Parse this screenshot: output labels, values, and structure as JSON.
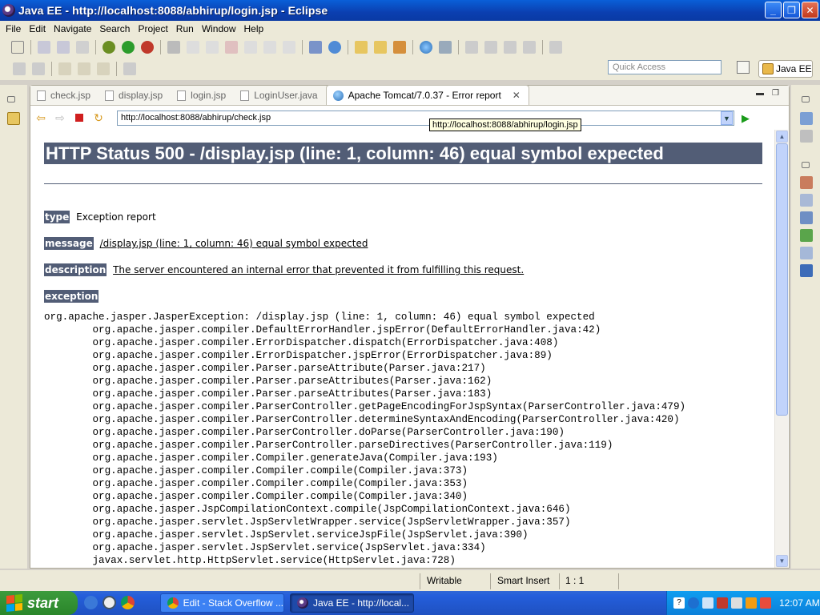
{
  "window": {
    "title": "Java EE - http://localhost:8088/abhirup/login.jsp - Eclipse"
  },
  "menu": [
    "File",
    "Edit",
    "Navigate",
    "Search",
    "Project",
    "Run",
    "Window",
    "Help"
  ],
  "toolbar": {
    "quick_access_placeholder": "Quick Access",
    "perspective_label": "Java EE"
  },
  "tabs": [
    {
      "label": "check.jsp"
    },
    {
      "label": "display.jsp"
    },
    {
      "label": "login.jsp"
    },
    {
      "label": "LoginUser.java"
    },
    {
      "label": "Apache Tomcat/7.0.37 - Error report"
    }
  ],
  "browser": {
    "url": "http://localhost:8088/abhirup/check.jsp",
    "tooltip": "http://localhost:8088/abhirup/login.jsp"
  },
  "page": {
    "heading": "HTTP Status 500 - /display.jsp (line: 1, column: 46) equal symbol expected",
    "type_label": "type",
    "type_value": "Exception report",
    "message_label": "message",
    "message_value": "/display.jsp (line: 1, column: 46) equal symbol expected",
    "description_label": "description",
    "description_value": "The server encountered an internal error that prevented it from fulfilling this request.",
    "exception_label": "exception",
    "stack_trace": "org.apache.jasper.JasperException: /display.jsp (line: 1, column: 46) equal symbol expected\n\torg.apache.jasper.compiler.DefaultErrorHandler.jspError(DefaultErrorHandler.java:42)\n\torg.apache.jasper.compiler.ErrorDispatcher.dispatch(ErrorDispatcher.java:408)\n\torg.apache.jasper.compiler.ErrorDispatcher.jspError(ErrorDispatcher.java:89)\n\torg.apache.jasper.compiler.Parser.parseAttribute(Parser.java:217)\n\torg.apache.jasper.compiler.Parser.parseAttributes(Parser.java:162)\n\torg.apache.jasper.compiler.Parser.parseAttributes(Parser.java:183)\n\torg.apache.jasper.compiler.ParserController.getPageEncodingForJspSyntax(ParserController.java:479)\n\torg.apache.jasper.compiler.ParserController.determineSyntaxAndEncoding(ParserController.java:420)\n\torg.apache.jasper.compiler.ParserController.doParse(ParserController.java:190)\n\torg.apache.jasper.compiler.ParserController.parseDirectives(ParserController.java:119)\n\torg.apache.jasper.compiler.Compiler.generateJava(Compiler.java:193)\n\torg.apache.jasper.compiler.Compiler.compile(Compiler.java:373)\n\torg.apache.jasper.compiler.Compiler.compile(Compiler.java:353)\n\torg.apache.jasper.compiler.Compiler.compile(Compiler.java:340)\n\torg.apache.jasper.JspCompilationContext.compile(JspCompilationContext.java:646)\n\torg.apache.jasper.servlet.JspServletWrapper.service(JspServletWrapper.java:357)\n\torg.apache.jasper.servlet.JspServlet.serviceJspFile(JspServlet.java:390)\n\torg.apache.jasper.servlet.JspServlet.service(JspServlet.java:334)\n\tjavax.servlet.http.HttpServlet.service(HttpServlet.java:728)"
  },
  "status": {
    "writable": "Writable",
    "insert_mode": "Smart Insert",
    "position": "1 : 1"
  },
  "taskbar": {
    "start_label": "start",
    "tasks": [
      {
        "label": "Edit - Stack Overflow ..."
      },
      {
        "label": "Java EE - http://local..."
      }
    ],
    "clock": "12:07 AM"
  },
  "colors": {
    "heading_bg": "#525d76",
    "title_bar": "#0b3fb0",
    "taskbar": "#245edb"
  }
}
